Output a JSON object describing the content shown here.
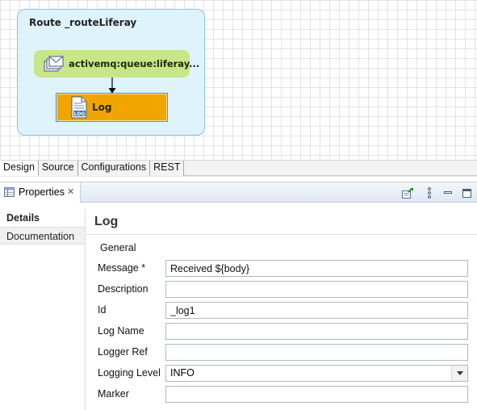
{
  "design": {
    "route_title": "Route _routeLiferay",
    "from_node_label": "activemq:queue:liferay...",
    "from_node_icon": "envelope-stack-icon",
    "log_node_label": "Log",
    "log_node_icon": "log-file-icon",
    "colors": {
      "route_fill": "#dff3fb",
      "from_node_fill": "#c9e58a",
      "log_node_fill": "#f0a500"
    }
  },
  "editor_tabs": [
    {
      "label": "Design",
      "active": true
    },
    {
      "label": "Source",
      "active": false
    },
    {
      "label": "Configurations",
      "active": false
    },
    {
      "label": "REST",
      "active": false
    }
  ],
  "properties_view": {
    "tab_label": "Properties",
    "tab_icon": "properties-table-icon",
    "toolbar_icons": [
      "pin-editor-icon",
      "view-menu-icon",
      "minimize-icon",
      "maximize-icon"
    ]
  },
  "sidebar": {
    "items": [
      {
        "label": "Details",
        "selected": true
      },
      {
        "label": "Documentation",
        "selected": false
      }
    ]
  },
  "form": {
    "title": "Log",
    "section": "General",
    "fields": {
      "message": {
        "label": "Message *",
        "value": "Received ${body}"
      },
      "description": {
        "label": "Description",
        "value": ""
      },
      "id": {
        "label": "Id",
        "value": "_log1"
      },
      "log_name": {
        "label": "Log Name",
        "value": ""
      },
      "logger_ref": {
        "label": "Logger Ref",
        "value": ""
      },
      "logging_level": {
        "label": "Logging Level",
        "value": "INFO"
      },
      "marker": {
        "label": "Marker",
        "value": ""
      }
    }
  }
}
